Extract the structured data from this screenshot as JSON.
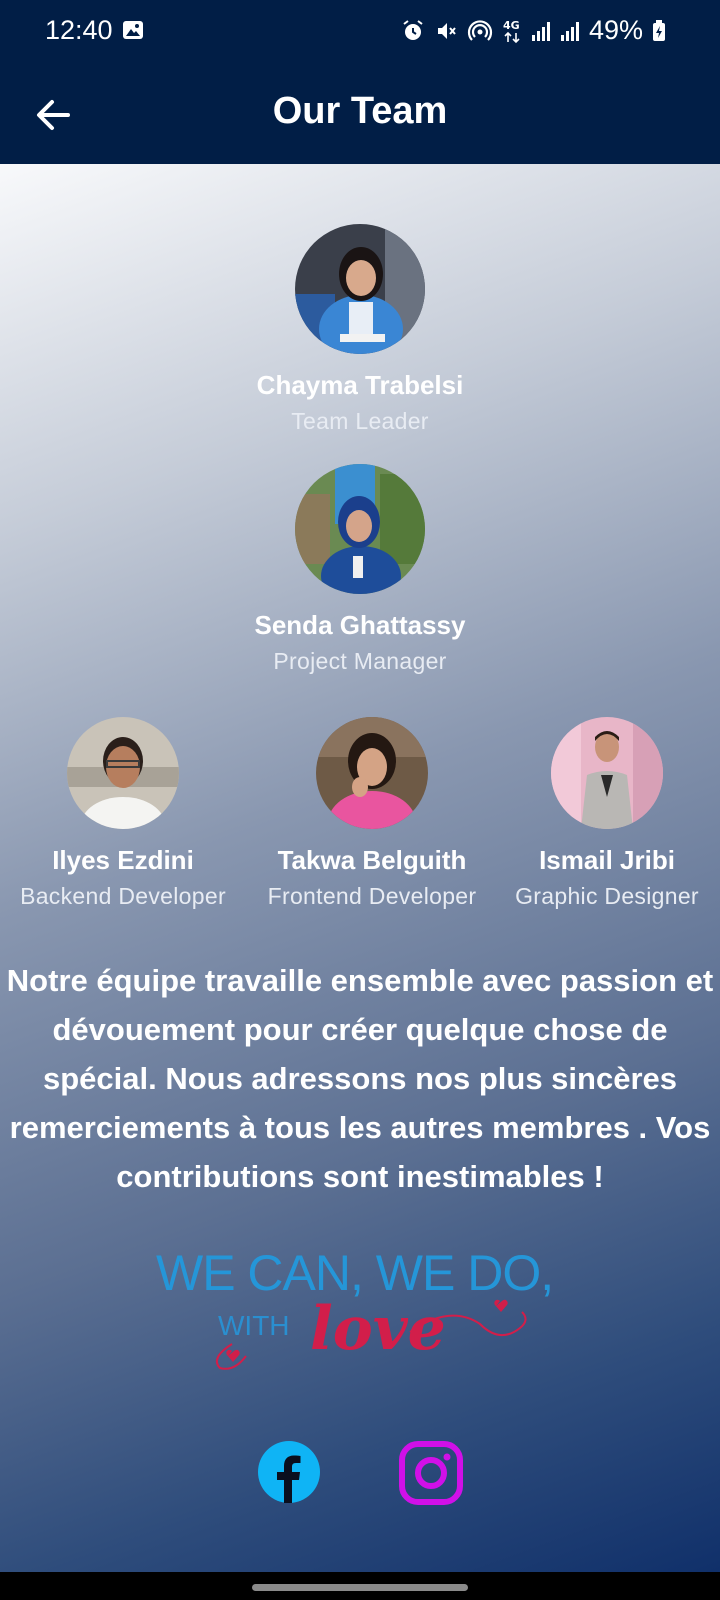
{
  "status_bar": {
    "time": "12:40",
    "battery_percent": "49%",
    "network": "4G",
    "icons": [
      "image-icon",
      "alarm-icon",
      "mute-icon",
      "hotspot-icon",
      "signal-icon",
      "signal-icon",
      "battery-icon"
    ]
  },
  "app_bar": {
    "title": "Our Team",
    "back_icon": "arrow-left-icon"
  },
  "team": [
    {
      "name": "Chayma Trabelsi",
      "role": "Team Leader"
    },
    {
      "name": "Senda Ghattassy",
      "role": "Project Manager"
    },
    {
      "name": "Ilyes Ezdini",
      "role": "Backend Developer"
    },
    {
      "name": "Takwa Belguith",
      "role": "Frontend Developer"
    },
    {
      "name": "Ismail Jribi",
      "role": "Graphic Designer"
    }
  ],
  "message": "Notre équipe travaille ensemble avec passion et dévouement pour créer quelque chose de spécial. Nous adressons nos plus sincères remerciements à tous les autres membres . Vos contributions sont inestimables !",
  "slogan": {
    "line1": "WE CAN, WE DO,",
    "with": "WITH",
    "love": "love"
  },
  "social": {
    "facebook_icon": "facebook-icon",
    "instagram_icon": "instagram-icon"
  },
  "colors": {
    "app_bar": "#011e46",
    "slogan_blue": "#2596d8",
    "slogan_red": "#d21e4a",
    "facebook": "#0fb4f5",
    "instagram": "#d010e8"
  }
}
